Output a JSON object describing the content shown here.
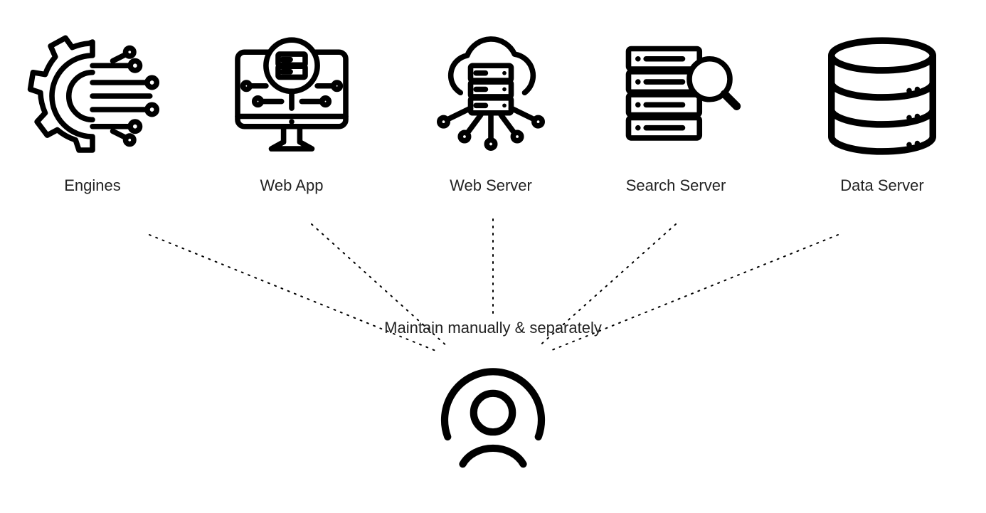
{
  "nodes": [
    {
      "id": "engines",
      "label": "Engines"
    },
    {
      "id": "web-app",
      "label": "Web App"
    },
    {
      "id": "web-server",
      "label": "Web Server"
    },
    {
      "id": "search-server",
      "label": "Search Server"
    },
    {
      "id": "data-server",
      "label": "Data Server"
    }
  ],
  "caption": "Maintain manually & separately",
  "user": {
    "id": "user"
  }
}
